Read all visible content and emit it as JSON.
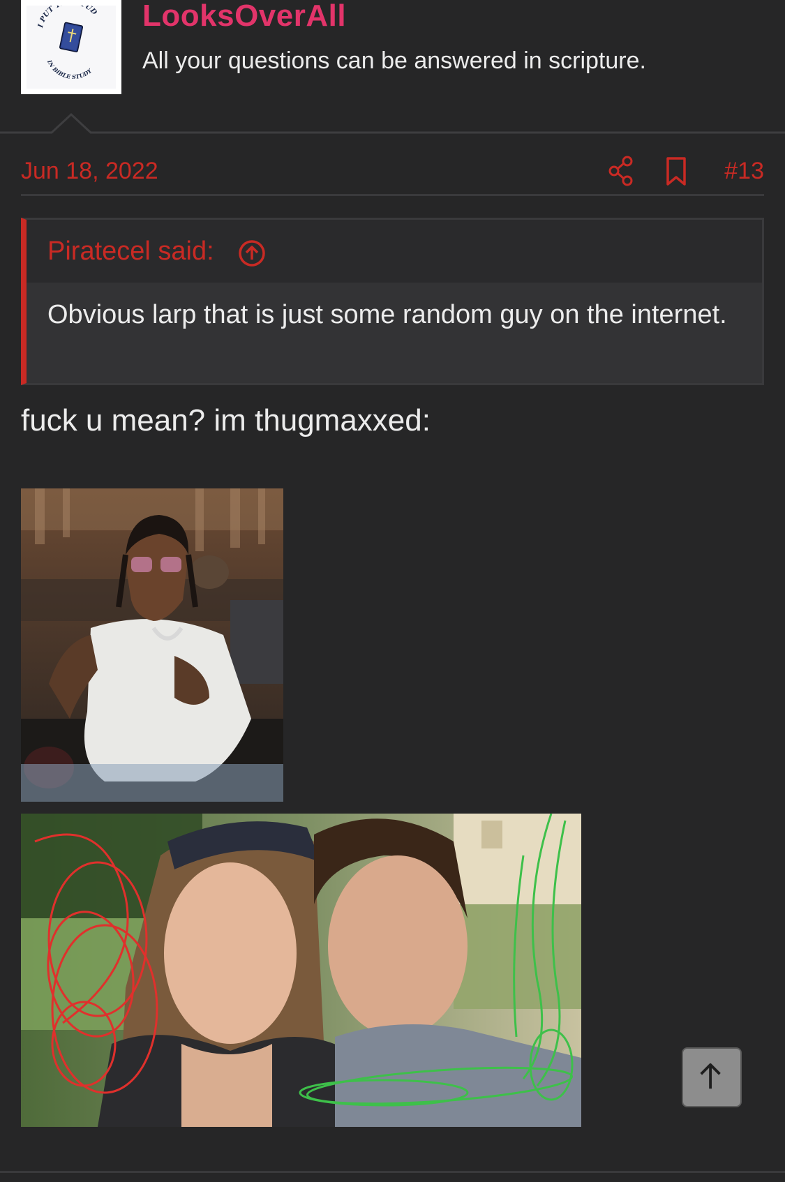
{
  "user": {
    "name": "LooksOverAll",
    "tagline": "All your questions can be answered in scripture.",
    "avatar_text_top": "I PUT THE STUD",
    "avatar_text_bottom": "IN BIBLE STUDY"
  },
  "post": {
    "date": "Jun 18, 2022",
    "number": "#13",
    "share_icon": "share-icon",
    "bookmark_icon": "bookmark-icon",
    "text": "fuck u mean? im thugmaxxed:"
  },
  "quote": {
    "author": "Piratecel said:",
    "up_icon": "arrow-up-circle-icon",
    "body": "Obvious larp that is just some random guy on the internet."
  },
  "scroll_top": {
    "icon": "arrow-up-icon"
  },
  "colors": {
    "background": "#262627",
    "accent_red": "#c92a24",
    "username_pink": "#e2346a",
    "text": "#ececec"
  }
}
